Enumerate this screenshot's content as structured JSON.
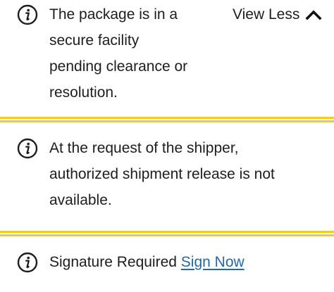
{
  "colors": {
    "divider": "#f2cc1f",
    "text": "#1d1d1d",
    "link": "#1f67b5"
  },
  "notices": [
    {
      "icon": "info-icon",
      "lines": [
        "The package is in a",
        "secure facility",
        "pending clearance or",
        "resolution."
      ],
      "toggle_label": "View Less",
      "toggle_icon": "chevron-up-icon"
    },
    {
      "icon": "info-icon",
      "lines": [
        "At the request of the shipper,",
        "authorized shipment release is not",
        "available."
      ]
    },
    {
      "icon": "info-icon",
      "text": "Signature Required",
      "link_label": "Sign Now"
    }
  ]
}
